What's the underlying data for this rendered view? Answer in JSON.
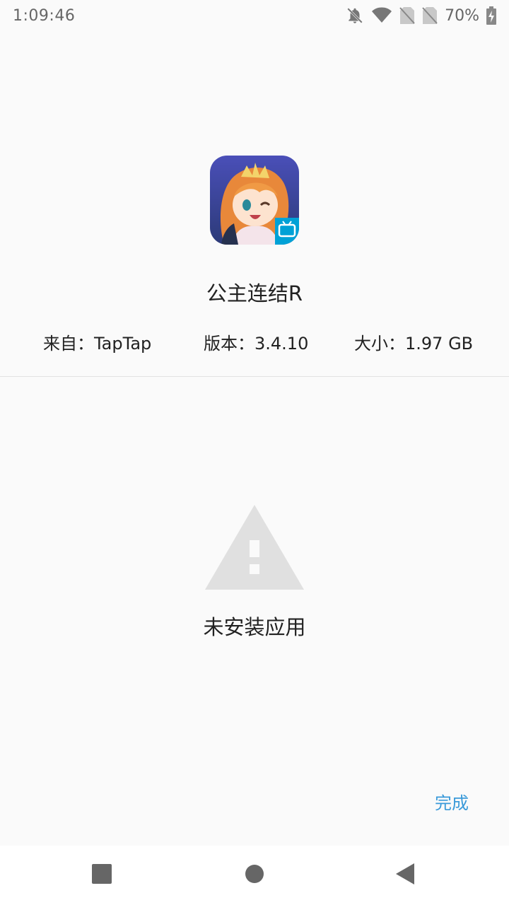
{
  "status_bar": {
    "time": "1:09:46",
    "battery_percent": "70%",
    "icons": [
      "notifications-off-icon",
      "wifi-icon",
      "sim-none-icon",
      "sim-none-icon",
      "battery-charging-icon"
    ]
  },
  "app": {
    "icon_name": "app-icon",
    "name": "公主连结R",
    "source": "来自：TapTap",
    "version": "版本：3.4.10",
    "size": "大小：1.97 GB"
  },
  "result": {
    "icon_name": "warning-icon",
    "message": "未安装应用"
  },
  "actions": {
    "done_label": "完成"
  },
  "nav": {
    "items": [
      "recents-icon",
      "home-icon",
      "back-icon"
    ]
  },
  "colors": {
    "background": "#fafafa",
    "accent": "#3a9ad9",
    "warning_gray": "#e0e0e0",
    "status_text": "#666666"
  }
}
